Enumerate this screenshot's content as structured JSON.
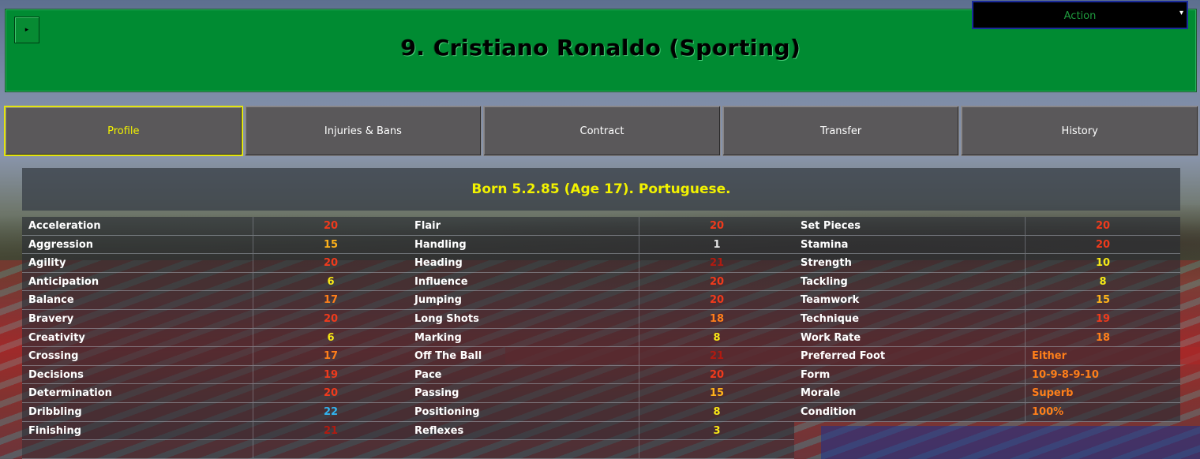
{
  "header": {
    "title": "9. Cristiano Ronaldo (Sporting)",
    "menu_arrow": "▸",
    "action_label": "Action",
    "action_arrow": "▾"
  },
  "tabs": [
    {
      "label": "Profile",
      "active": true
    },
    {
      "label": "Injuries & Bans"
    },
    {
      "label": "Contract"
    },
    {
      "label": "Transfer"
    },
    {
      "label": "History"
    }
  ],
  "profile": {
    "born": "Born 5.2.85 (Age 17). Portuguese."
  },
  "attributes": {
    "col1": [
      {
        "name": "Acceleration",
        "value": "20",
        "color": "#f03a1c"
      },
      {
        "name": "Aggression",
        "value": "15",
        "color": "#ffb21a"
      },
      {
        "name": "Agility",
        "value": "20",
        "color": "#f03a1c"
      },
      {
        "name": "Anticipation",
        "value": "6",
        "color": "#f7e816"
      },
      {
        "name": "Balance",
        "value": "17",
        "color": "#ff7f1a"
      },
      {
        "name": "Bravery",
        "value": "20",
        "color": "#f03a1c"
      },
      {
        "name": "Creativity",
        "value": "6",
        "color": "#f7e816"
      },
      {
        "name": "Crossing",
        "value": "17",
        "color": "#ff7f1a"
      },
      {
        "name": "Decisions",
        "value": "19",
        "color": "#f03a1c"
      },
      {
        "name": "Determination",
        "value": "20",
        "color": "#f03a1c"
      },
      {
        "name": "Dribbling",
        "value": "22",
        "color": "#32b4f0"
      },
      {
        "name": "Finishing",
        "value": "21",
        "color": "#b21a10"
      },
      {
        "name": "",
        "value": "",
        "color": ""
      }
    ],
    "col2": [
      {
        "name": "Flair",
        "value": "20",
        "color": "#f03a1c"
      },
      {
        "name": "Handling",
        "value": "1",
        "color": "#e6e6e6"
      },
      {
        "name": "Heading",
        "value": "21",
        "color": "#b21a10"
      },
      {
        "name": "Influence",
        "value": "20",
        "color": "#f03a1c"
      },
      {
        "name": "Jumping",
        "value": "20",
        "color": "#f03a1c"
      },
      {
        "name": "Long Shots",
        "value": "18",
        "color": "#ff7f1a"
      },
      {
        "name": "Marking",
        "value": "8",
        "color": "#f7e816"
      },
      {
        "name": "Off The Ball",
        "value": "21",
        "color": "#b21a10"
      },
      {
        "name": "Pace",
        "value": "20",
        "color": "#f03a1c"
      },
      {
        "name": "Passing",
        "value": "15",
        "color": "#ffb21a"
      },
      {
        "name": "Positioning",
        "value": "8",
        "color": "#f7e816"
      },
      {
        "name": "Reflexes",
        "value": "3",
        "color": "#f7e816"
      },
      {
        "name": "",
        "value": "",
        "color": ""
      }
    ],
    "col3": [
      {
        "name": "Set Pieces",
        "value": "20",
        "color": "#f03a1c"
      },
      {
        "name": "Stamina",
        "value": "20",
        "color": "#f03a1c"
      },
      {
        "name": "Strength",
        "value": "10",
        "color": "#f7e816"
      },
      {
        "name": "Tackling",
        "value": "8",
        "color": "#f7e816"
      },
      {
        "name": "Teamwork",
        "value": "15",
        "color": "#ffb21a"
      },
      {
        "name": "Technique",
        "value": "19",
        "color": "#f03a1c"
      },
      {
        "name": "Work Rate",
        "value": "18",
        "color": "#ff7f1a"
      },
      {
        "name": "Preferred Foot",
        "value": "Either",
        "color": "#ff7f1a",
        "align": "left"
      },
      {
        "name": "Form",
        "value": "10-9-8-9-10",
        "color": "#ff7f1a",
        "align": "left"
      },
      {
        "name": "Morale",
        "value": "Superb",
        "color": "#ff7f1a",
        "align": "left"
      },
      {
        "name": "Condition",
        "value": "100%",
        "color": "#ff7f1a",
        "align": "left"
      }
    ]
  }
}
